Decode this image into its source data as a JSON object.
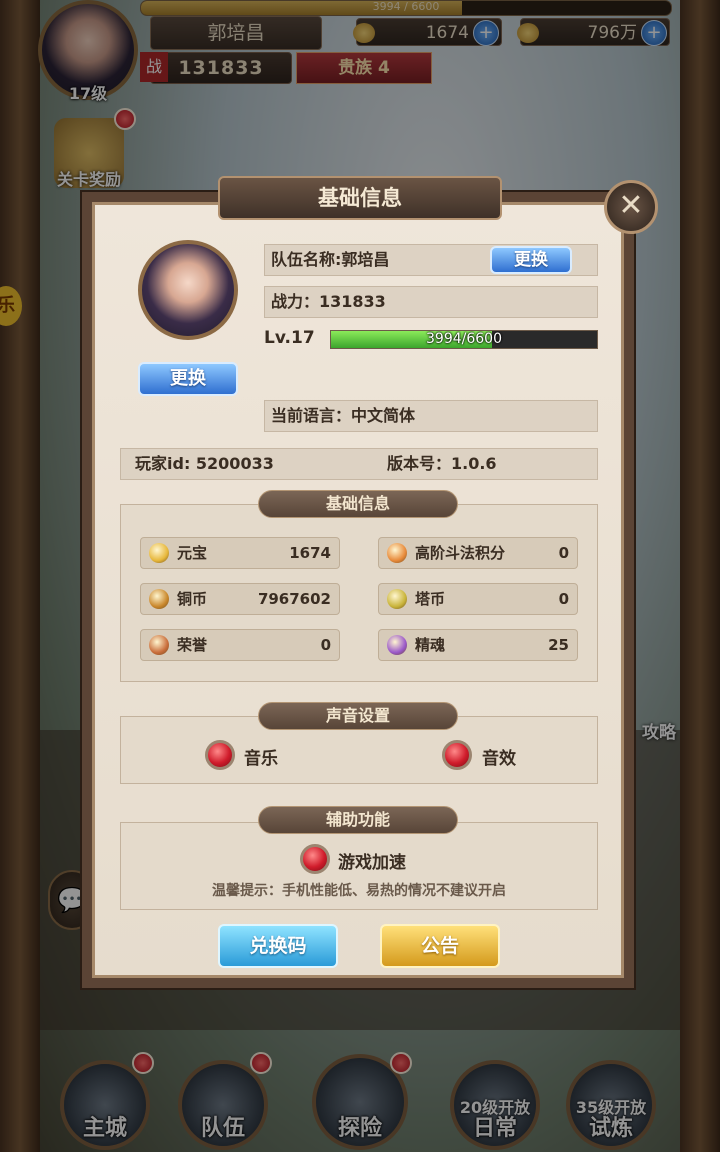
{
  "hud": {
    "exp_text": "3994 / 6600",
    "exp_ratio": 0.605,
    "level_text": "17级",
    "player_name": "郭培昌",
    "power_badge": "战",
    "power_value": "131833",
    "noble_text": "贵族 4",
    "gold_value": "1674",
    "copper_value": "796万",
    "plus_symbol": "+",
    "stage_reward_label": "关卡奖励",
    "side_badge": "乐",
    "strategy_label": "攻略",
    "chat_icon_glyph": "💬"
  },
  "nav": {
    "items": [
      {
        "label": "主城",
        "lock": ""
      },
      {
        "label": "队伍",
        "lock": ""
      },
      {
        "label": "探险",
        "lock": ""
      },
      {
        "label": "日常",
        "lock": "20级开放"
      },
      {
        "label": "试炼",
        "lock": "35级开放"
      }
    ]
  },
  "modal": {
    "title": "基础信息",
    "close_glyph": "✕",
    "team_name_label": "队伍名称:郭培昌",
    "change_label": "更换",
    "power_label": "战力：131833",
    "level_label": "Lv.17",
    "exp_text": "3994/6600",
    "exp_ratio": 0.605,
    "language_label": "当前语言：中文简体",
    "player_id_label": "玩家id: 5200033",
    "version_label": "版本号：1.0.6",
    "section_basic": "基础信息",
    "currencies": [
      {
        "name": "元宝",
        "value": "1674",
        "icon": "yuanbao-icon",
        "color": "#e7b73a"
      },
      {
        "name": "高阶斗法积分",
        "value": "0",
        "icon": "duel-points-icon",
        "color": "#e88a3a"
      },
      {
        "name": "铜币",
        "value": "7967602",
        "icon": "copper-coin-icon",
        "color": "#c9872b"
      },
      {
        "name": "塔币",
        "value": "0",
        "icon": "tower-coin-icon",
        "color": "#c9b43a"
      },
      {
        "name": "荣誉",
        "value": "0",
        "icon": "honor-icon",
        "color": "#c96d3a"
      },
      {
        "name": "精魂",
        "value": "25",
        "icon": "spirit-icon",
        "color": "#9a58c9"
      }
    ],
    "section_sound": "声音设置",
    "music_label": "音乐",
    "sfx_label": "音效",
    "section_assist": "辅助功能",
    "speedup_label": "游戏加速",
    "tip_text": "温馨提示：手机性能低、易热的情况不建议开启",
    "redeem_label": "兑换码",
    "notice_label": "公告"
  }
}
